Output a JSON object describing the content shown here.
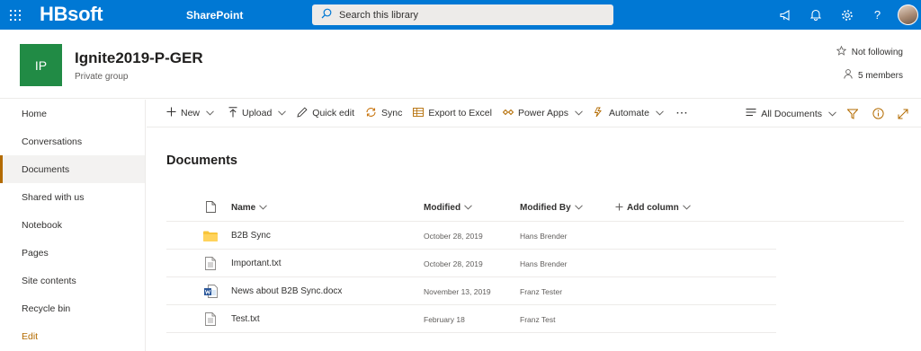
{
  "suite": {
    "brand": "HBsoft",
    "app_name": "SharePoint",
    "search_placeholder": "Search this library",
    "icons": [
      "waffle-icon",
      "megaphone-icon",
      "bell-icon",
      "gear-icon",
      "help-icon"
    ],
    "accent": "#0078d4"
  },
  "site": {
    "logo_text": "IP",
    "logo_color": "#218b45",
    "title": "Ignite2019-P-GER",
    "subtitle": "Private group",
    "follow_label": "Not following",
    "members_label": "5 members"
  },
  "nav": {
    "items": [
      {
        "label": "Home"
      },
      {
        "label": "Conversations"
      },
      {
        "label": "Documents",
        "selected": true
      },
      {
        "label": "Shared with us"
      },
      {
        "label": "Notebook"
      },
      {
        "label": "Pages"
      },
      {
        "label": "Site contents"
      },
      {
        "label": "Recycle bin"
      }
    ],
    "edit_label": "Edit"
  },
  "commands": {
    "new": "New",
    "upload": "Upload",
    "quick_edit": "Quick edit",
    "sync": "Sync",
    "export": "Export to Excel",
    "power_apps": "Power Apps",
    "automate": "Automate",
    "more": "···",
    "view": "All Documents"
  },
  "library": {
    "title": "Documents",
    "columns": {
      "name": "Name",
      "modified": "Modified",
      "modified_by": "Modified By",
      "add_column": "Add column"
    },
    "files": [
      {
        "type": "folder",
        "name": "B2B Sync",
        "modified": "October 28, 2019",
        "modified_by": "Hans Brender"
      },
      {
        "type": "txt",
        "name": "Important.txt",
        "modified": "October 28, 2019",
        "modified_by": "Hans Brender"
      },
      {
        "type": "docx",
        "name": "News about B2B Sync.docx",
        "modified": "November 13, 2019",
        "modified_by": "Franz Tester"
      },
      {
        "type": "txt",
        "name": "Test.txt",
        "modified": "February 18",
        "modified_by": "Franz Test"
      }
    ]
  }
}
